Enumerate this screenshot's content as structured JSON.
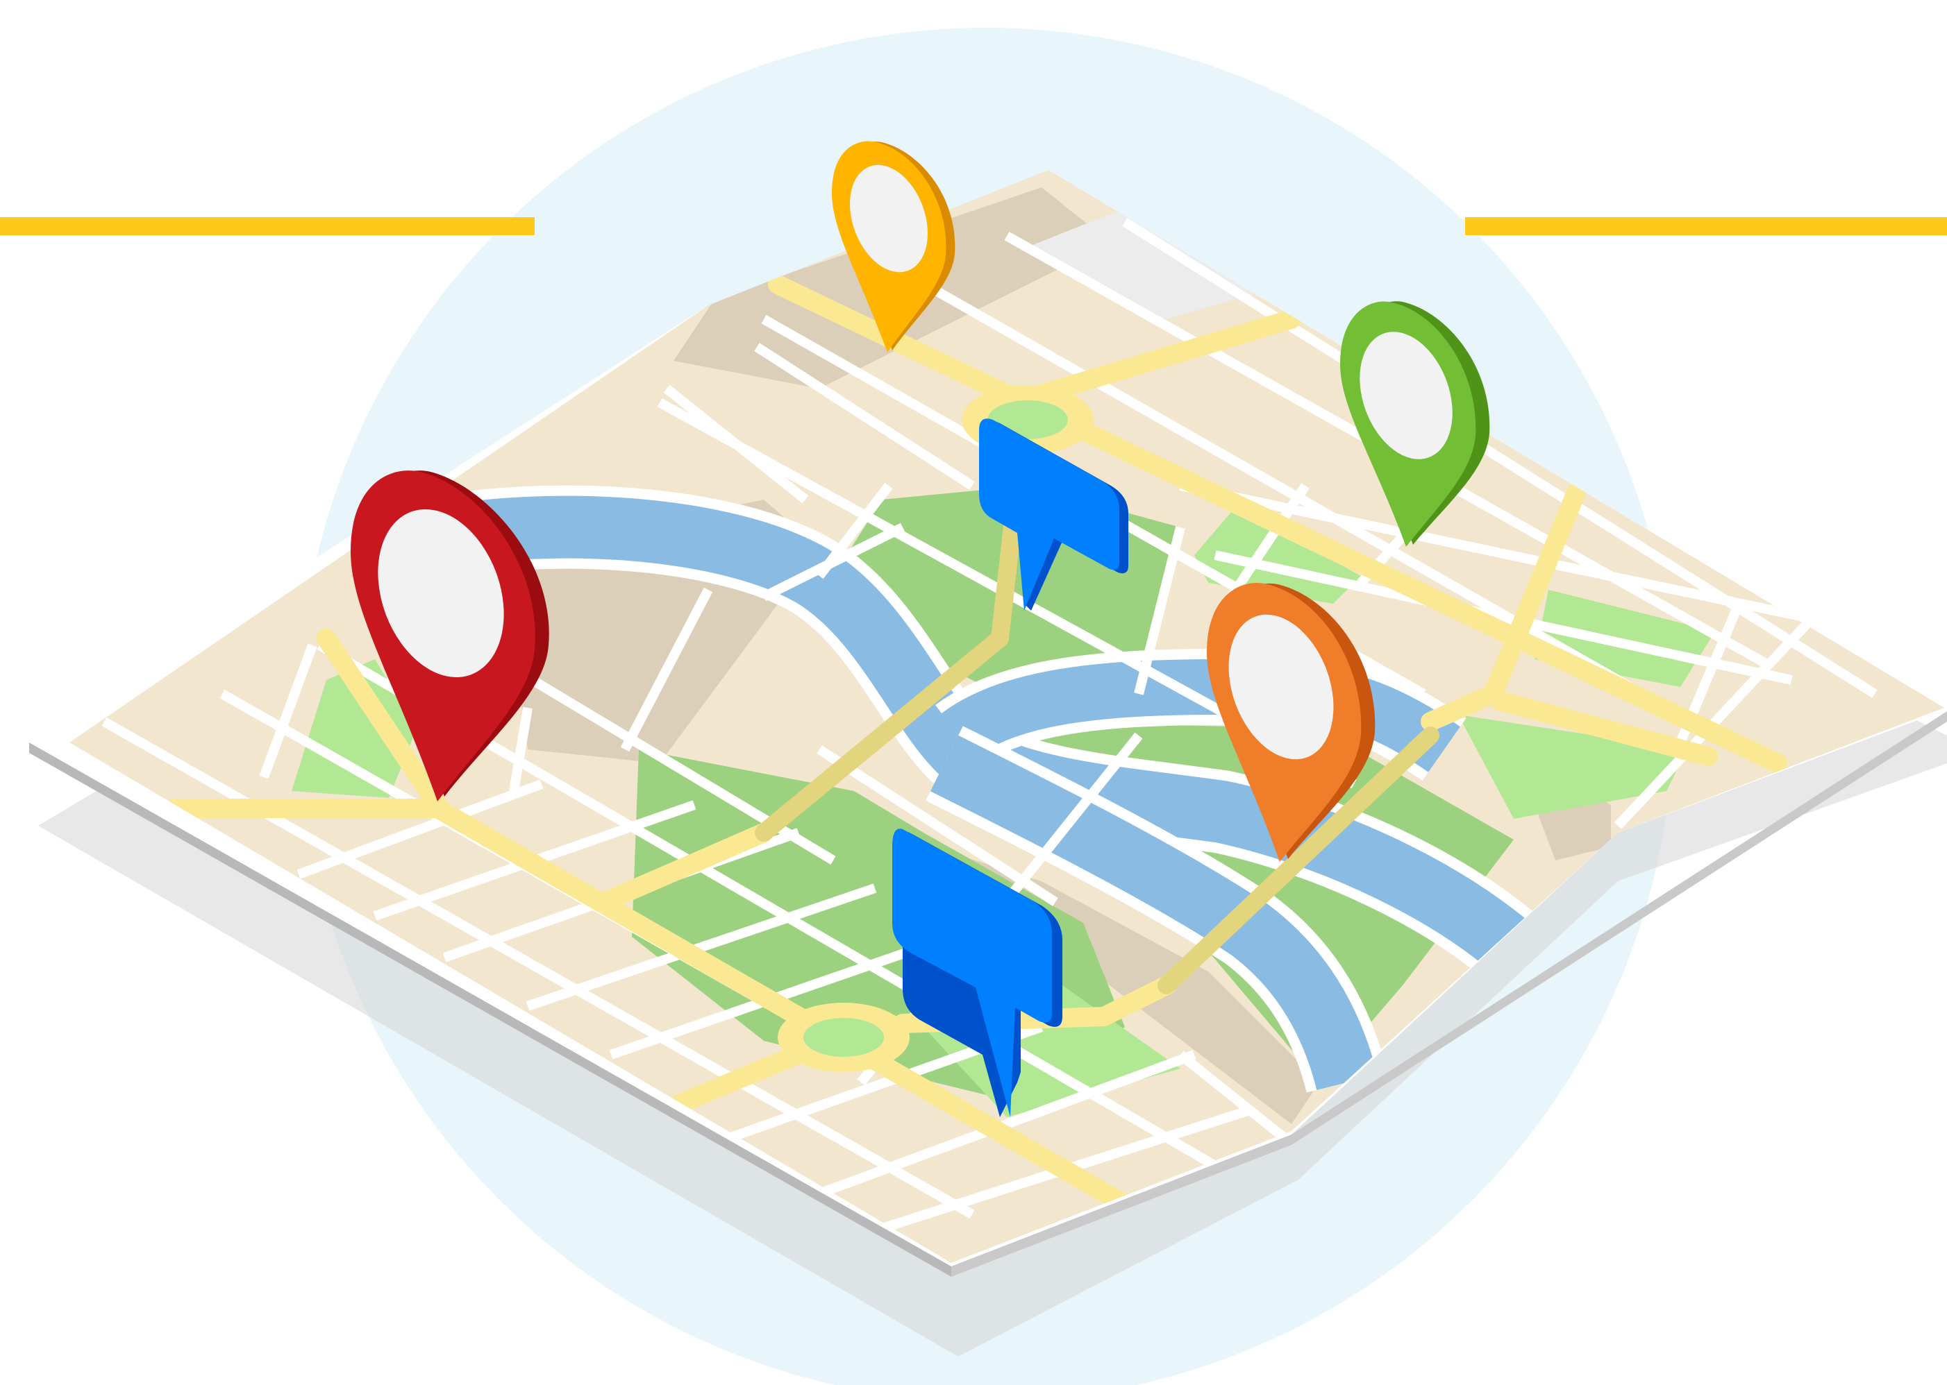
{
  "illustration": {
    "subject": "isometric-city-map",
    "pins": [
      {
        "name": "red-location-pin-icon",
        "color": "#c8171e",
        "shade": "#9b0c10"
      },
      {
        "name": "yellow-location-pin-icon",
        "color": "#ffb400",
        "shade": "#d98c00"
      },
      {
        "name": "green-location-pin-icon",
        "color": "#72bf36",
        "shade": "#4f9418"
      },
      {
        "name": "orange-location-pin-icon",
        "color": "#f07d2a",
        "shade": "#c9560e"
      }
    ],
    "flags": [
      {
        "name": "blue-flag-marker-icon",
        "color": "#0080ff",
        "shade": "#0052cc"
      },
      {
        "name": "blue-flag-marker-icon",
        "color": "#0080ff",
        "shade": "#0052cc"
      }
    ],
    "colors": {
      "background_circle": "#e8f6fb",
      "accent_line": "#fec919",
      "map_base": "#f3e6cf",
      "map_block_dark": "#dccfb9",
      "park": "#9bd17f",
      "park_light": "#b2e894",
      "river": "#8abbe3",
      "road_main": "#fbe893",
      "road_minor": "#ffffff",
      "map_edge": "#ebebeb",
      "shadow": "#d6d6d6"
    }
  }
}
